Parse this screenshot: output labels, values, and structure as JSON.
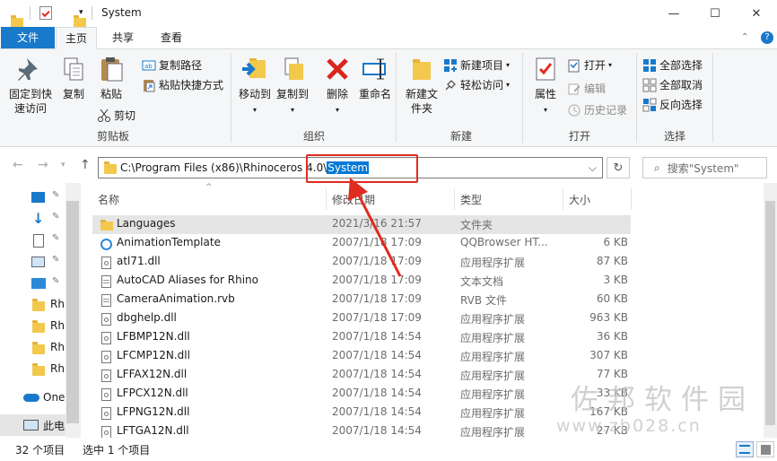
{
  "window": {
    "title": "System",
    "minimize": "—",
    "maximize": "☐",
    "close": "✕"
  },
  "ribbon_tabs": [
    "文件",
    "主页",
    "共享",
    "查看"
  ],
  "ribbon": {
    "clipboard": {
      "pin": "固定到快速访问",
      "copy": "复制",
      "paste": "粘贴",
      "copy_path": "复制路径",
      "paste_shortcut": "粘贴快捷方式",
      "cut": "剪切",
      "label": "剪贴板"
    },
    "organize": {
      "move_to": "移动到",
      "copy_to": "复制到",
      "delete": "删除",
      "rename": "重命名",
      "label": "组织"
    },
    "new": {
      "new_folder": "新建文件夹",
      "new_item": "新建项目",
      "easy_access": "轻松访问",
      "label": "新建"
    },
    "open": {
      "properties": "属性",
      "open": "打开",
      "edit": "编辑",
      "history": "历史记录",
      "label": "打开"
    },
    "select": {
      "select_all": "全部选择",
      "select_none": "全部取消",
      "invert": "反向选择",
      "label": "选择"
    }
  },
  "address": {
    "path_prefix": "C:\\Program Files (x86)\\Rhinoceros 4.0\\",
    "path_selected": "System",
    "search_placeholder": "搜索\"System\""
  },
  "navpane": {
    "items": [
      "Rh",
      "Rh",
      "Rh",
      "Rh",
      "One",
      "此电"
    ]
  },
  "columns": {
    "name": "名称",
    "date": "修改日期",
    "type": "类型",
    "size": "大小"
  },
  "files": [
    {
      "name": "Languages",
      "date": "2021/3/16 21:57",
      "type": "文件夹",
      "size": "",
      "icon": "folder-icon"
    },
    {
      "name": "AnimationTemplate",
      "date": "2007/1/18 17:09",
      "type": "QQBrowser HT...",
      "size": "6 KB",
      "icon": "browser-file-icon"
    },
    {
      "name": "atl71.dll",
      "date": "2007/1/18 17:09",
      "type": "应用程序扩展",
      "size": "87 KB",
      "icon": "dll-file-icon"
    },
    {
      "name": "AutoCAD Aliases for Rhino",
      "date": "2007/1/18 17:09",
      "type": "文本文档",
      "size": "3 KB",
      "icon": "text-file-icon"
    },
    {
      "name": "CameraAnimation.rvb",
      "date": "2007/1/18 17:09",
      "type": "RVB 文件",
      "size": "60 KB",
      "icon": "file-icon"
    },
    {
      "name": "dbghelp.dll",
      "date": "2007/1/18 17:09",
      "type": "应用程序扩展",
      "size": "963 KB",
      "icon": "dll-file-icon"
    },
    {
      "name": "LFBMP12N.dll",
      "date": "2007/1/18 14:54",
      "type": "应用程序扩展",
      "size": "36 KB",
      "icon": "dll-file-icon"
    },
    {
      "name": "LFCMP12N.dll",
      "date": "2007/1/18 14:54",
      "type": "应用程序扩展",
      "size": "307 KB",
      "icon": "dll-file-icon"
    },
    {
      "name": "LFFAX12N.dll",
      "date": "2007/1/18 14:54",
      "type": "应用程序扩展",
      "size": "77 KB",
      "icon": "dll-file-icon"
    },
    {
      "name": "LFPCX12N.dll",
      "date": "2007/1/18 14:54",
      "type": "应用程序扩展",
      "size": "33 KB",
      "icon": "dll-file-icon"
    },
    {
      "name": "LFPNG12N.dll",
      "date": "2007/1/18 14:54",
      "type": "应用程序扩展",
      "size": "167 KB",
      "icon": "dll-file-icon"
    },
    {
      "name": "LFTGA12N.dll",
      "date": "2007/1/18 14:54",
      "type": "应用程序扩展",
      "size": "27 KB",
      "icon": "dll-file-icon"
    }
  ],
  "status": {
    "count": "32 个项目",
    "selected": "选中 1 个项目"
  },
  "watermark": {
    "line1": "佐邦软件园",
    "line2": "www.zb028.cn"
  },
  "colors": {
    "file_tab": "#1979ca",
    "selection": "#0078d7",
    "annotation": "#e02b20",
    "folder": "#f2c94c"
  }
}
